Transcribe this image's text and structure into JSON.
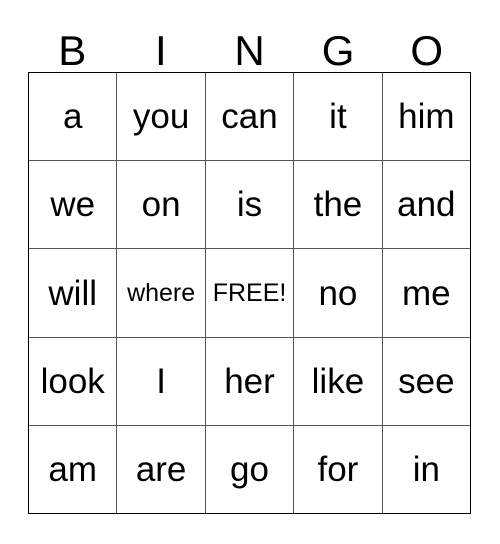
{
  "card": {
    "title": "BINGO",
    "headers": [
      "B",
      "I",
      "N",
      "G",
      "O"
    ],
    "colors": {
      "background": "#ffffff",
      "text": "#000000",
      "outer_border": "#000000",
      "inner_grid_line": "#555555"
    },
    "rows": [
      {
        "cells": [
          {
            "text": "a",
            "size": "normal",
            "free": false
          },
          {
            "text": "you",
            "size": "normal",
            "free": false
          },
          {
            "text": "can",
            "size": "normal",
            "free": false
          },
          {
            "text": "it",
            "size": "normal",
            "free": false
          },
          {
            "text": "him",
            "size": "normal",
            "free": false
          }
        ]
      },
      {
        "cells": [
          {
            "text": "we",
            "size": "normal",
            "free": false
          },
          {
            "text": "on",
            "size": "normal",
            "free": false
          },
          {
            "text": "is",
            "size": "normal",
            "free": false
          },
          {
            "text": "the",
            "size": "normal",
            "free": false
          },
          {
            "text": "and",
            "size": "normal",
            "free": false
          }
        ]
      },
      {
        "cells": [
          {
            "text": "will",
            "size": "normal",
            "free": false
          },
          {
            "text": "where",
            "size": "small",
            "free": false
          },
          {
            "text": "FREE!",
            "size": "small",
            "free": true
          },
          {
            "text": "no",
            "size": "normal",
            "free": false
          },
          {
            "text": "me",
            "size": "normal",
            "free": false
          }
        ]
      },
      {
        "cells": [
          {
            "text": "look",
            "size": "normal",
            "free": false
          },
          {
            "text": "I",
            "size": "normal",
            "free": false
          },
          {
            "text": "her",
            "size": "normal",
            "free": false
          },
          {
            "text": "like",
            "size": "normal",
            "free": false
          },
          {
            "text": "see",
            "size": "normal",
            "free": false
          }
        ]
      },
      {
        "cells": [
          {
            "text": "am",
            "size": "normal",
            "free": false
          },
          {
            "text": "are",
            "size": "normal",
            "free": false
          },
          {
            "text": "go",
            "size": "normal",
            "free": false
          },
          {
            "text": "for",
            "size": "normal",
            "free": false
          },
          {
            "text": "in",
            "size": "normal",
            "free": false
          }
        ]
      }
    ]
  }
}
